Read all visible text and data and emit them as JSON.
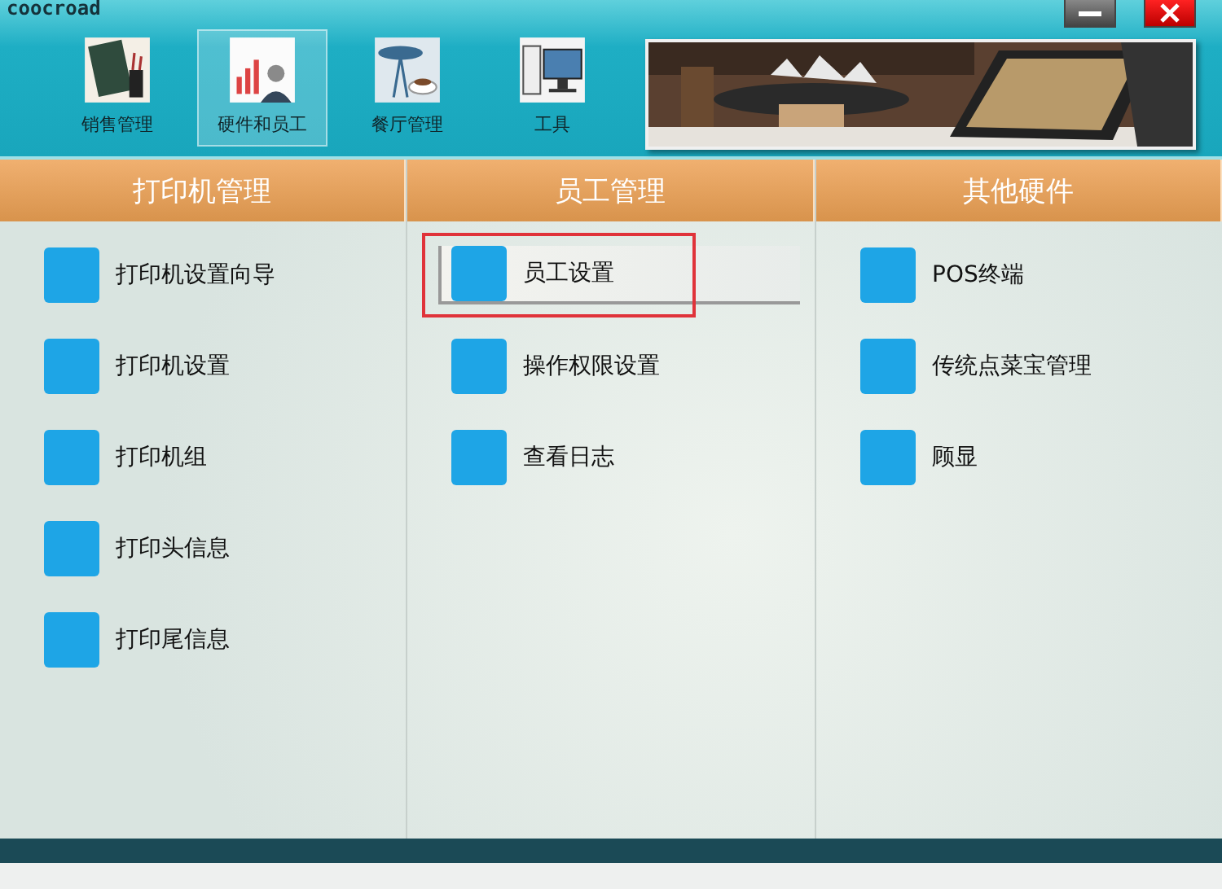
{
  "app": {
    "logo": "coocroad"
  },
  "tabs": [
    {
      "label": "销售管理",
      "selected": false,
      "kind": "book"
    },
    {
      "label": "硬件和员工",
      "selected": true,
      "kind": "chart"
    },
    {
      "label": "餐厅管理",
      "selected": false,
      "kind": "table"
    },
    {
      "label": "工具",
      "selected": false,
      "kind": "computer"
    }
  ],
  "columns": [
    {
      "title": "打印机管理",
      "items": [
        {
          "label": "打印机设置向导",
          "selected": false,
          "highlighted": false
        },
        {
          "label": "打印机设置",
          "selected": false,
          "highlighted": false
        },
        {
          "label": "打印机组",
          "selected": false,
          "highlighted": false
        },
        {
          "label": "打印头信息",
          "selected": false,
          "highlighted": false
        },
        {
          "label": "打印尾信息",
          "selected": false,
          "highlighted": false
        }
      ]
    },
    {
      "title": "员工管理",
      "items": [
        {
          "label": "员工设置",
          "selected": true,
          "highlighted": true
        },
        {
          "label": "操作权限设置",
          "selected": false,
          "highlighted": false
        },
        {
          "label": "查看日志",
          "selected": false,
          "highlighted": false
        }
      ]
    },
    {
      "title": "其他硬件",
      "items": [
        {
          "label": "POS终端",
          "selected": false,
          "highlighted": false
        },
        {
          "label": "传统点菜宝管理",
          "selected": false,
          "highlighted": false
        },
        {
          "label": "顾显",
          "selected": false,
          "highlighted": false
        }
      ]
    }
  ]
}
